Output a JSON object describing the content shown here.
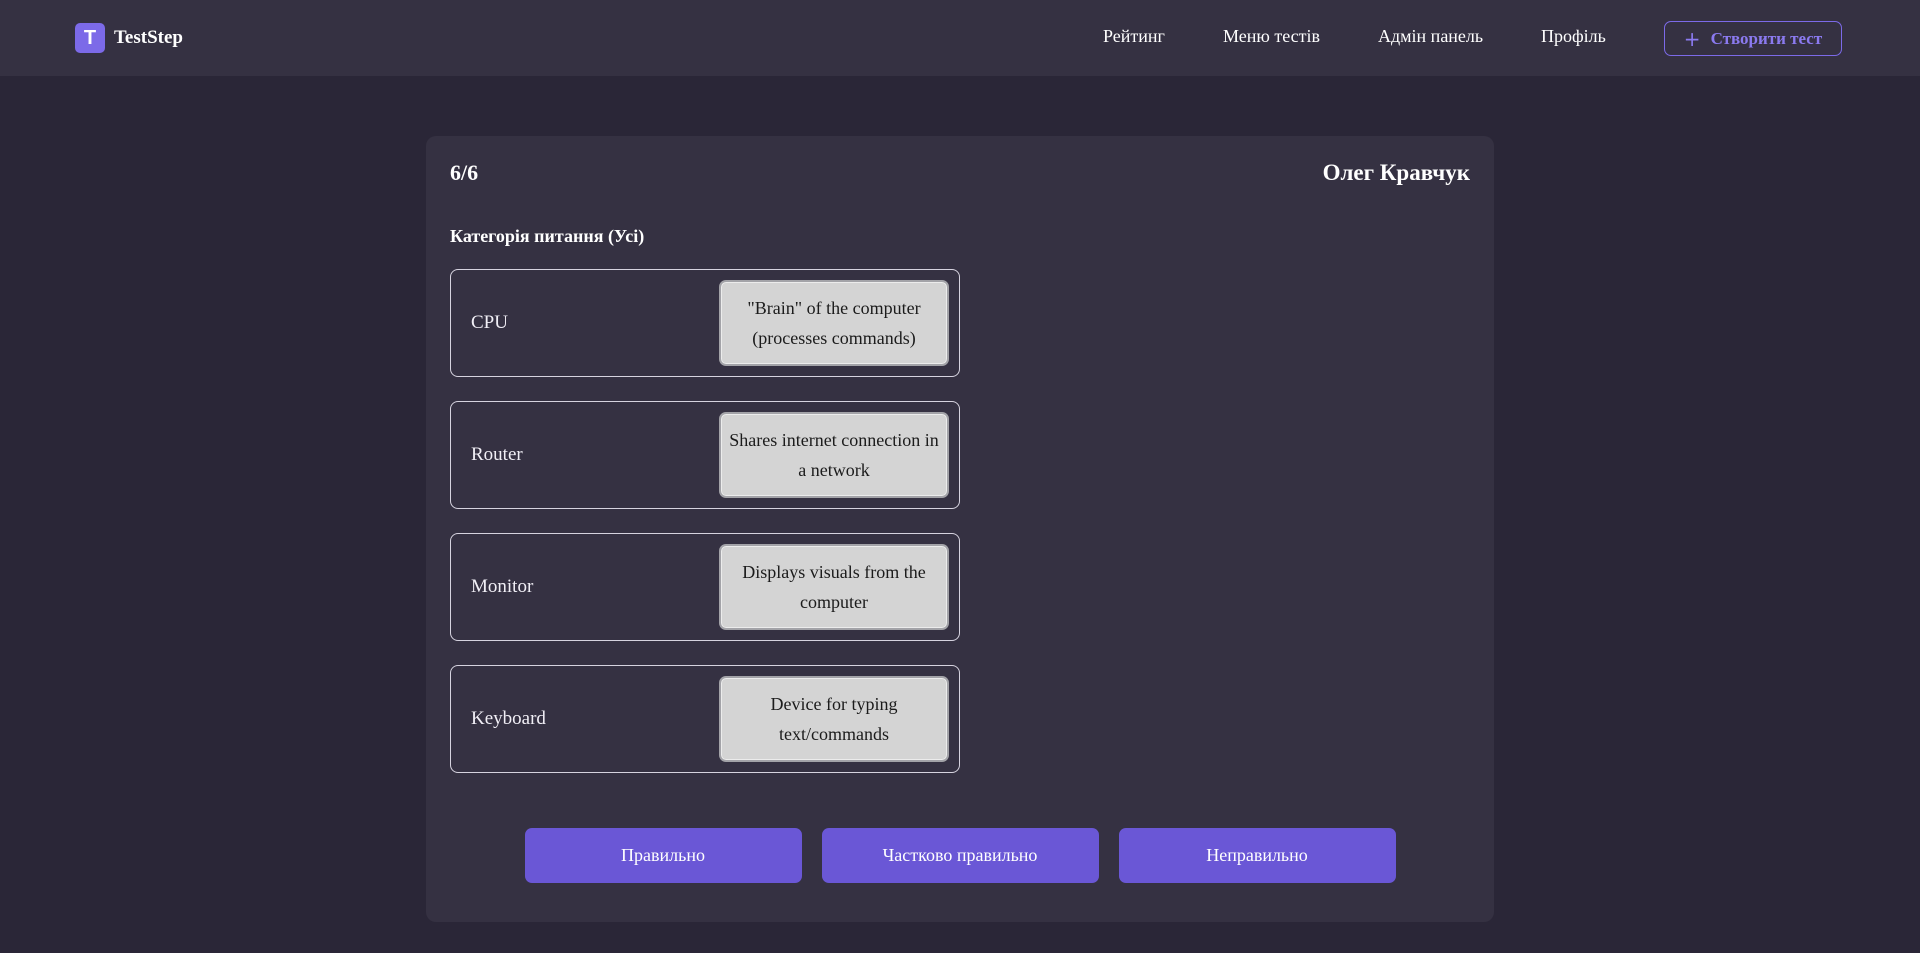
{
  "brand": {
    "logo_letter": "T",
    "name": "TestStep",
    "accent": "#7c6ae8"
  },
  "nav": {
    "rating": "Рейтинг",
    "tests_menu": "Меню тестів",
    "admin": "Адмін панель",
    "profile": "Профіль",
    "create_test": "Створити тест",
    "create_icon": "plus-icon"
  },
  "quiz": {
    "counter": "6/6",
    "user_name": "Олег Кравчук",
    "category_title": "Категорія питання (Усі)",
    "pairs": [
      {
        "term": "CPU",
        "answer": "\"Brain\" of the computer (processes commands)"
      },
      {
        "term": "Router",
        "answer": "Shares internet connection in a network"
      },
      {
        "term": "Monitor",
        "answer": "Displays visuals from the computer"
      },
      {
        "term": "Keyboard",
        "answer": "Device for typing text/commands"
      }
    ],
    "buttons": {
      "correct": "Правильно",
      "partial": "Частково правильно",
      "incorrect": "Неправильно"
    }
  },
  "colors": {
    "background": "#2a2637",
    "panel": "#353142",
    "button": "#6a57d6",
    "answer_tile": "#d4d4d4"
  }
}
